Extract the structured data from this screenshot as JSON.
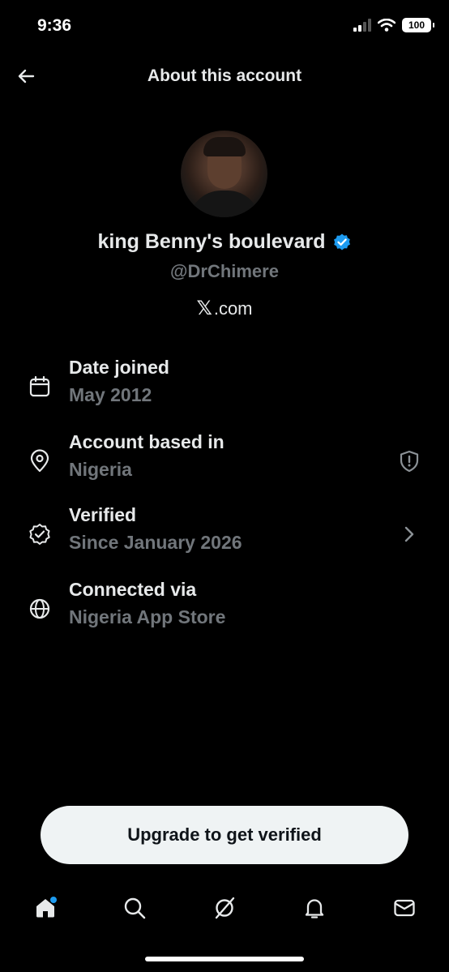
{
  "status_bar": {
    "time": "9:36",
    "battery": "100"
  },
  "header": {
    "title": "About this account"
  },
  "profile": {
    "display_name": "king Benny's boulevard",
    "handle": "@DrChimere",
    "source_logo": "𝕏",
    "source_text": ".com",
    "verified_color": "#1d9bf0"
  },
  "info": [
    {
      "icon": "calendar-icon",
      "label": "Date joined",
      "value": "May 2012"
    },
    {
      "icon": "location-pin-icon",
      "label": "Account based in",
      "value": "Nigeria",
      "trailing": "shield-alert-icon"
    },
    {
      "icon": "verified-badge-icon",
      "label": "Verified",
      "value": "Since January 2026",
      "trailing": "chevron-right-icon"
    },
    {
      "icon": "globe-icon",
      "label": "Connected via",
      "value": "Nigeria App Store"
    }
  ],
  "upgrade_button": {
    "label": "Upgrade to get verified"
  },
  "tabs": [
    {
      "name": "home",
      "icon": "home-icon",
      "active": true,
      "has_notification_dot": true
    },
    {
      "name": "search",
      "icon": "search-icon"
    },
    {
      "name": "grok",
      "icon": "grok-icon"
    },
    {
      "name": "notifications",
      "icon": "bell-icon"
    },
    {
      "name": "messages",
      "icon": "mail-icon"
    }
  ]
}
